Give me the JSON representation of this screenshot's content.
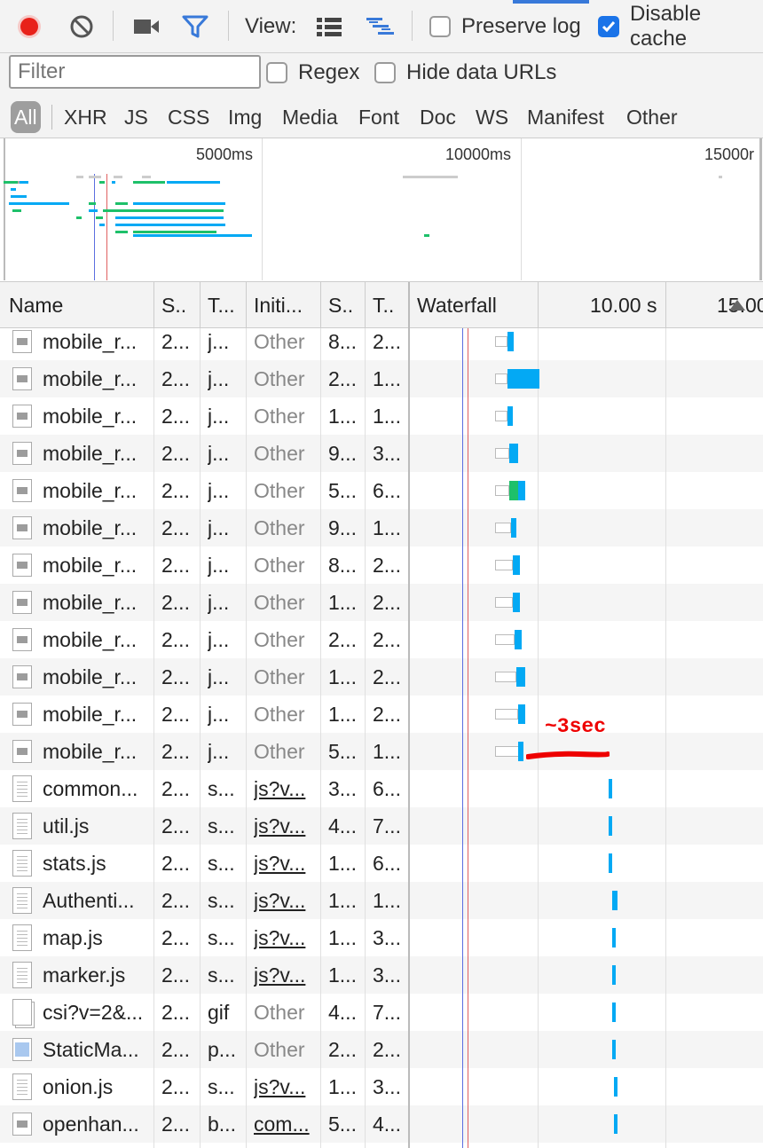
{
  "toolbar": {
    "view_label": "View:",
    "preserve_log": {
      "label": "Preserve log",
      "checked": false
    },
    "disable_cache": {
      "label": "Disable cache",
      "checked": true
    },
    "record_color": "#e8211a",
    "filter_icon_color": "#3879d9"
  },
  "filter": {
    "placeholder": "Filter",
    "regex_label": "Regex",
    "hide_data_urls_label": "Hide data URLs"
  },
  "types": [
    "All",
    "XHR",
    "JS",
    "CSS",
    "Img",
    "Media",
    "Font",
    "Doc",
    "WS",
    "Manifest",
    "Other"
  ],
  "overview": {
    "tick_labels": [
      "5000ms",
      "10000ms",
      "15000r"
    ]
  },
  "columns": {
    "name": "Name",
    "status": "S..",
    "type": "T...",
    "initiator": "Initi...",
    "size": "S..",
    "time": "T..",
    "waterfall": "Waterfall",
    "tick1": "10.00 s",
    "tick2": "15.00"
  },
  "rows": [
    {
      "name": "mobile_r...",
      "status": "2...",
      "type": "j...",
      "initiator": "Other",
      "size": "8...",
      "time": "2...",
      "icon": "img"
    },
    {
      "name": "mobile_r...",
      "status": "2...",
      "type": "j...",
      "initiator": "Other",
      "size": "2...",
      "time": "1...",
      "icon": "img"
    },
    {
      "name": "mobile_r...",
      "status": "2...",
      "type": "j...",
      "initiator": "Other",
      "size": "1...",
      "time": "1...",
      "icon": "img"
    },
    {
      "name": "mobile_r...",
      "status": "2...",
      "type": "j...",
      "initiator": "Other",
      "size": "9...",
      "time": "3...",
      "icon": "img"
    },
    {
      "name": "mobile_r...",
      "status": "2...",
      "type": "j...",
      "initiator": "Other",
      "size": "5...",
      "time": "6...",
      "icon": "img"
    },
    {
      "name": "mobile_r...",
      "status": "2...",
      "type": "j...",
      "initiator": "Other",
      "size": "9...",
      "time": "1...",
      "icon": "img"
    },
    {
      "name": "mobile_r...",
      "status": "2...",
      "type": "j...",
      "initiator": "Other",
      "size": "8...",
      "time": "2...",
      "icon": "img"
    },
    {
      "name": "mobile_r...",
      "status": "2...",
      "type": "j...",
      "initiator": "Other",
      "size": "1...",
      "time": "2...",
      "icon": "img"
    },
    {
      "name": "mobile_r...",
      "status": "2...",
      "type": "j...",
      "initiator": "Other",
      "size": "2...",
      "time": "2...",
      "icon": "img"
    },
    {
      "name": "mobile_r...",
      "status": "2...",
      "type": "j...",
      "initiator": "Other",
      "size": "1...",
      "time": "2...",
      "icon": "img"
    },
    {
      "name": "mobile_r...",
      "status": "2...",
      "type": "j...",
      "initiator": "Other",
      "size": "1...",
      "time": "2...",
      "icon": "img"
    },
    {
      "name": "mobile_r...",
      "status": "2...",
      "type": "j...",
      "initiator": "Other",
      "size": "5...",
      "time": "1...",
      "icon": "img"
    },
    {
      "name": "common...",
      "status": "2...",
      "type": "s...",
      "initiator": "js?v...",
      "size": "3...",
      "time": "6...",
      "icon": "doc"
    },
    {
      "name": "util.js",
      "status": "2...",
      "type": "s...",
      "initiator": "js?v...",
      "size": "4...",
      "time": "7...",
      "icon": "doc"
    },
    {
      "name": "stats.js",
      "status": "2...",
      "type": "s...",
      "initiator": "js?v...",
      "size": "1...",
      "time": "6...",
      "icon": "doc"
    },
    {
      "name": "Authenti...",
      "status": "2...",
      "type": "s...",
      "initiator": "js?v...",
      "size": "1...",
      "time": "1...",
      "icon": "doc"
    },
    {
      "name": "map.js",
      "status": "2...",
      "type": "s...",
      "initiator": "js?v...",
      "size": "1...",
      "time": "3...",
      "icon": "doc"
    },
    {
      "name": "marker.js",
      "status": "2...",
      "type": "s...",
      "initiator": "js?v...",
      "size": "1...",
      "time": "3...",
      "icon": "doc"
    },
    {
      "name": "csi?v=2&...",
      "status": "2...",
      "type": "gif",
      "initiator": "Other",
      "size": "4...",
      "time": "7...",
      "icon": "gif"
    },
    {
      "name": "StaticMa...",
      "status": "2...",
      "type": "p...",
      "initiator": "Other",
      "size": "2...",
      "time": "2...",
      "icon": "png"
    },
    {
      "name": "onion.js",
      "status": "2...",
      "type": "s...",
      "initiator": "js?v...",
      "size": "1...",
      "time": "3...",
      "icon": "doc"
    },
    {
      "name": "openhan...",
      "status": "2...",
      "type": "b...",
      "initiator": "com...",
      "size": "5...",
      "time": "4...",
      "icon": "img"
    }
  ],
  "annotation": {
    "text": "~3sec",
    "color": "#ee0000"
  },
  "colors": {
    "waterfall_bar": "#03a9f4",
    "waterfall_green": "#1ec06a",
    "dom_content_line": "#5b6ee0",
    "load_line": "#e06060"
  }
}
